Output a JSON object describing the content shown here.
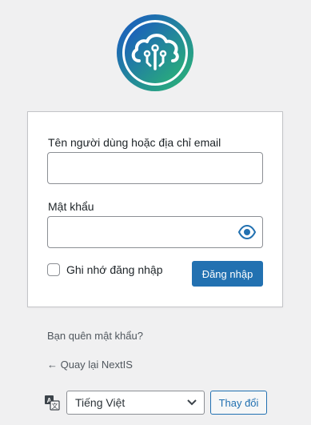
{
  "brand": {
    "logo_icon": "cloud-circuit-logo-icon",
    "colors": {
      "gradient_start": "#1a56c4",
      "gradient_end": "#2bb673"
    }
  },
  "form": {
    "username_label": "Tên người dùng hoặc địa chỉ email",
    "username_value": "",
    "password_label": "Mật khẩu",
    "password_value": "",
    "show_password_icon": "eye-icon",
    "remember_label": "Ghi nhớ đăng nhập",
    "remember_checked": false,
    "submit_label": "Đăng nhập"
  },
  "links": {
    "lost_password": "Bạn quên mật khẩu?",
    "back_to_site": "← Quay lại NextIS"
  },
  "language": {
    "icon": "translate-icon",
    "selected": "Tiếng Việt",
    "change_label": "Thay đổi"
  },
  "colors": {
    "accent": "#2271b1",
    "background": "#f0f0f1"
  }
}
